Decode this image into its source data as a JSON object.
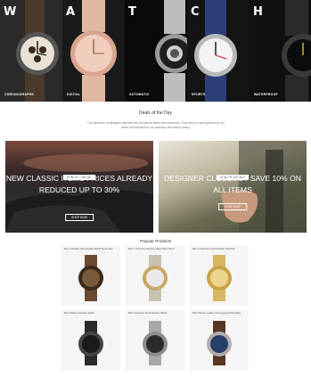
{
  "hero": {
    "panels": [
      {
        "letter": "W",
        "caption": "Chronographs"
      },
      {
        "letter": "A",
        "caption": "Digital"
      },
      {
        "letter": "T",
        "caption": "Automatic"
      },
      {
        "letter": "C",
        "caption": "Sports"
      },
      {
        "letter": "H",
        "caption": "Waterproof"
      }
    ]
  },
  "deals": {
    "title": "Deals of the Day",
    "text": "Our selection of designer watches are all special deals and closeouts. Each item is hand-picked by our team and backed by our warranty and return policy."
  },
  "banners": [
    {
      "tag": "Deal of the Day",
      "headline": "New Classic Items Prices Already Reduced Up To 30%",
      "button": "Shop Now"
    },
    {
      "tag": "Deal of the Day",
      "headline": "Designer Closeout Save 10% On All Items",
      "button": "Shop Now"
    }
  ],
  "popular": {
    "title": "Popular Products",
    "products": [
      {
        "name": "Men's Wooden Chronograph Watch Brown Dial"
      },
      {
        "name": "Men's Two-Tone Stainless Steel Watch Silver"
      },
      {
        "name": "Men's Gold-Tone Quartz Watch Gold Dial"
      },
      {
        "name": "Men's Black Automatic Watch"
      },
      {
        "name": "Men's Stainless Steel Skeleton Watch"
      },
      {
        "name": "Men's Brown Leather Chronograph Watch Blue"
      }
    ]
  }
}
